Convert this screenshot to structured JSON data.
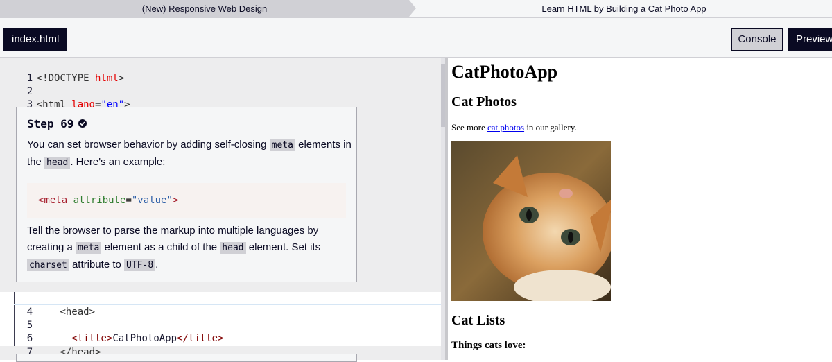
{
  "breadcrumb": {
    "course": "(New) Responsive Web Design",
    "project": "Learn HTML by Building a Cat Photo App"
  },
  "toolbar": {
    "file_tab": "index.html",
    "console_label": "Console",
    "preview_label": "Preview"
  },
  "editor": {
    "line_numbers": [
      "1",
      "2",
      "3",
      "4",
      "5",
      "6",
      "7"
    ],
    "line1": {
      "open": "<!DOCTYPE ",
      "keyword": "html",
      "close": ">"
    },
    "line3": {
      "open": "<html ",
      "attr": "lang",
      "eq": "=",
      "value": "\"en\"",
      "close": ">"
    },
    "line4": {
      "text": "<head>"
    },
    "line6": {
      "open": "<title>",
      "content": "CatPhotoApp",
      "close": "</title>"
    },
    "line7": {
      "text": "</head>"
    }
  },
  "step": {
    "title": "Step 69",
    "para1_a": "You can set browser behavior by adding self-closing ",
    "para1_code1": "meta",
    "para1_b": " elements in the ",
    "para1_code2": "head",
    "para1_c": ". Here's an example:",
    "example": {
      "open": "<meta ",
      "attr": "attribute",
      "eq": "=",
      "value": "\"value\"",
      "close": ">"
    },
    "para2_a": "Tell the browser to parse the markup into multiple languages by creating a ",
    "para2_code1": "meta",
    "para2_b": " element as a child of the ",
    "para2_code2": "head",
    "para2_c": " element. Set its ",
    "para2_code3": "charset",
    "para2_d": " attribute to ",
    "para2_code4": "UTF-8",
    "para2_e": "."
  },
  "preview": {
    "heading": "CatPhotoApp",
    "section1": "Cat Photos",
    "para_before": "See more ",
    "link": "cat photos",
    "para_after": " in our gallery.",
    "section2": "Cat Lists",
    "subheading": "Things cats love:"
  },
  "colors": {
    "dark": "#0a0a23",
    "editor_bg": "#ededee",
    "tag": "#800000",
    "attr": "#e50000",
    "string": "#0000ff"
  }
}
